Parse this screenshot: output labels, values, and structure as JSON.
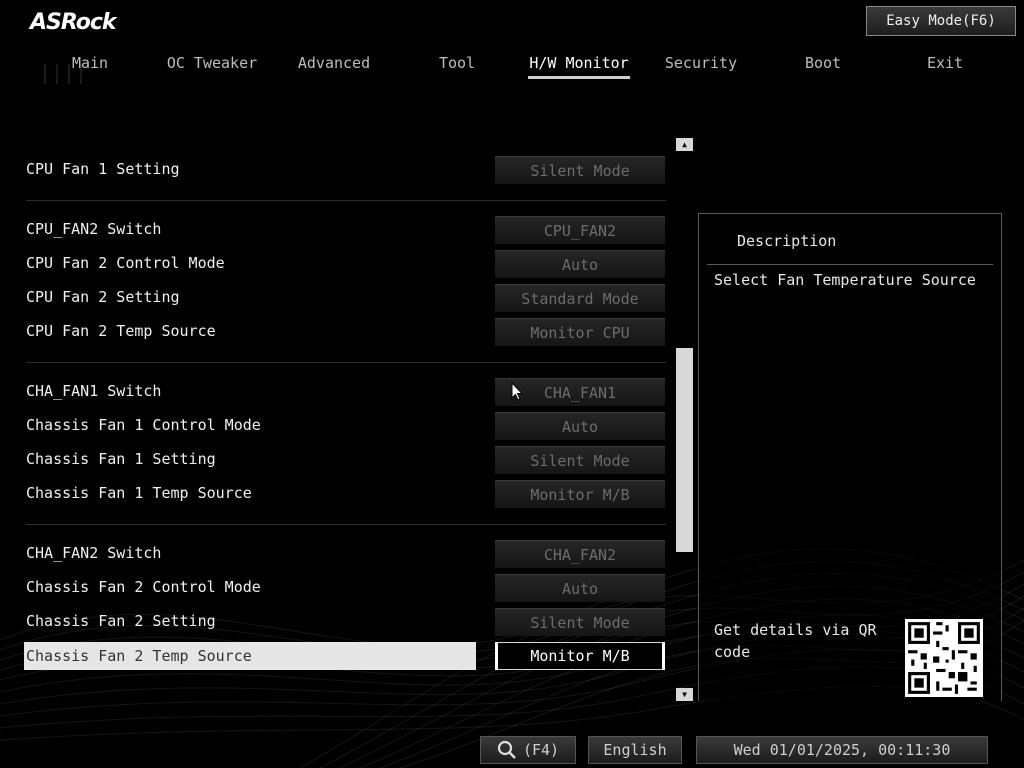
{
  "brand": "ASRock",
  "easy_mode": "Easy Mode(F6)",
  "tabs": [
    "Main",
    "OC Tweaker",
    "Advanced",
    "Tool",
    "H/W Monitor",
    "Security",
    "Boot",
    "Exit"
  ],
  "active_tab": "H/W Monitor",
  "settings": [
    {
      "label": "CPU Fan 1 Setting",
      "value": "Silent Mode"
    },
    {
      "label": "CPU_FAN2 Switch",
      "value": "CPU_FAN2"
    },
    {
      "label": "CPU Fan 2 Control Mode",
      "value": "Auto"
    },
    {
      "label": "CPU Fan 2 Setting",
      "value": "Standard Mode"
    },
    {
      "label": "CPU Fan 2 Temp Source",
      "value": "Monitor CPU"
    },
    {
      "label": "CHA_FAN1 Switch",
      "value": "CHA_FAN1"
    },
    {
      "label": "Chassis Fan 1 Control Mode",
      "value": "Auto"
    },
    {
      "label": "Chassis Fan 1 Setting",
      "value": "Silent Mode"
    },
    {
      "label": "Chassis Fan 1 Temp Source",
      "value": "Monitor M/B"
    },
    {
      "label": "CHA_FAN2 Switch",
      "value": "CHA_FAN2"
    },
    {
      "label": "Chassis Fan 2 Control Mode",
      "value": "Auto"
    },
    {
      "label": "Chassis Fan 2 Setting",
      "value": "Silent Mode"
    },
    {
      "label": "Chassis Fan 2 Temp Source",
      "value": "Monitor M/B"
    }
  ],
  "description": {
    "title": "Description",
    "text": "Select Fan Temperature Source",
    "qr_text": "Get details via QR code"
  },
  "bottom": {
    "search_key": "(F4)",
    "language": "English",
    "datetime": "Wed 01/01/2025, 00:11:30"
  }
}
